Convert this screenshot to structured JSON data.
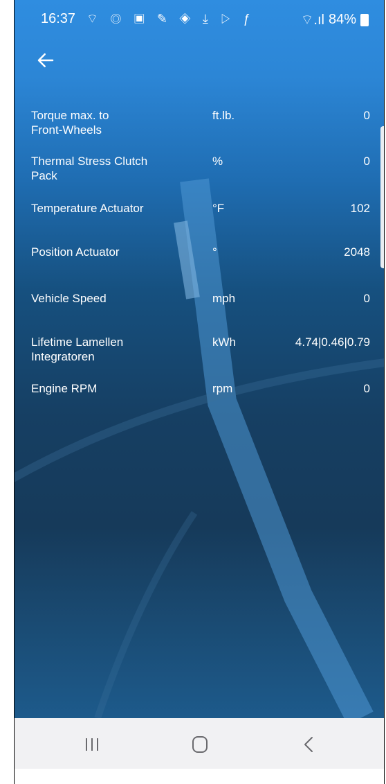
{
  "status_bar": {
    "time": "16:37",
    "notification_icons": [
      "wifi-calling-icon",
      "sync-icon",
      "mail-icon",
      "wrench-icon",
      "shield-icon",
      "download-icon",
      "play-store-icon",
      "facebook-icon"
    ],
    "battery_percent": "84%"
  },
  "header": {
    "back_icon": "back-arrow-icon"
  },
  "rows": [
    {
      "label": "Torque max. to\nFront-Wheels",
      "unit": "ft.lb.",
      "value": "0"
    },
    {
      "label": "Thermal Stress Clutch\nPack",
      "unit": "%",
      "value": "0"
    },
    {
      "label": "Temperature Actuator",
      "unit": "°F",
      "value": "102"
    },
    {
      "label": "Position Actuator",
      "unit": "°",
      "value": "2048"
    },
    {
      "label": "Vehicle Speed",
      "unit": "mph",
      "value": "0"
    },
    {
      "label": "Lifetime Lamellen\nIntegratoren",
      "unit": "kWh",
      "value": "4.74|0.46|0.79"
    },
    {
      "label": "Engine RPM",
      "unit": "rpm",
      "value": "0"
    }
  ],
  "nav_bar": {
    "recent_icon": "recent-apps-icon",
    "home_icon": "home-icon",
    "back_icon": "back-icon"
  },
  "colors": {
    "accent": "#2f8de0",
    "background_dark": "#163a5a",
    "navbar": "#f1f1f3"
  }
}
